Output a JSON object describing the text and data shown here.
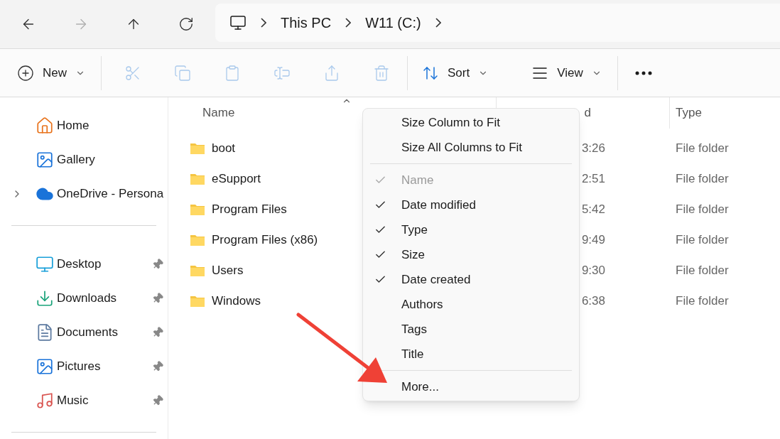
{
  "nav": [
    {
      "kind": "back",
      "disabled": false
    },
    {
      "kind": "forward",
      "disabled": true
    },
    {
      "kind": "up",
      "disabled": false
    },
    {
      "kind": "refresh",
      "disabled": false
    }
  ],
  "breadcrumb": [
    "This PC",
    "W11 (C:)"
  ],
  "toolbar": {
    "new": "New",
    "actions": [
      {
        "kind": "cut",
        "disabled": true
      },
      {
        "kind": "copy",
        "disabled": true
      },
      {
        "kind": "paste",
        "disabled": true
      },
      {
        "kind": "rename",
        "disabled": true
      },
      {
        "kind": "share",
        "disabled": true
      },
      {
        "kind": "delete",
        "disabled": true
      }
    ],
    "sort": "Sort",
    "view": "View"
  },
  "sidebar": {
    "groups": [
      [
        {
          "kind": "home",
          "label": "Home",
          "pinned": false,
          "expandable": false
        },
        {
          "kind": "gallery",
          "label": "Gallery",
          "pinned": false,
          "expandable": false
        },
        {
          "kind": "cloud",
          "label": "OneDrive - Persona",
          "pinned": false,
          "expandable": true
        }
      ],
      [
        {
          "kind": "desktop",
          "label": "Desktop",
          "pinned": true,
          "expandable": false
        },
        {
          "kind": "downloads",
          "label": "Downloads",
          "pinned": true,
          "expandable": false
        },
        {
          "kind": "documents",
          "label": "Documents",
          "pinned": true,
          "expandable": false
        },
        {
          "kind": "pictures",
          "label": "Pictures",
          "pinned": true,
          "expandable": false
        },
        {
          "kind": "music",
          "label": "Music",
          "pinned": true,
          "expandable": false
        }
      ]
    ]
  },
  "table": {
    "columns": [
      "Name",
      "d",
      "Type"
    ],
    "rows": [
      {
        "name": "boot",
        "column_2": "3:26",
        "type": "File folder"
      },
      {
        "name": "eSupport",
        "column_2": "2:51",
        "type": "File folder"
      },
      {
        "name": "Program Files",
        "column_2": "5:42",
        "type": "File folder"
      },
      {
        "name": "Program Files (x86)",
        "column_2": "9:49",
        "type": "File folder"
      },
      {
        "name": "Users",
        "column_2": "9:30",
        "type": "File folder"
      },
      {
        "name": "Windows",
        "column_2": "6:38",
        "type": "File folder"
      }
    ]
  },
  "context_menu": {
    "items": [
      {
        "kind": "action",
        "label": "Size Column to Fit"
      },
      {
        "kind": "action",
        "label": "Size All Columns to Fit"
      },
      {
        "kind": "separator"
      },
      {
        "kind": "check",
        "label": "Name",
        "checked": true,
        "disabled": true
      },
      {
        "kind": "check",
        "label": "Date modified",
        "checked": true,
        "disabled": false
      },
      {
        "kind": "check",
        "label": "Type",
        "checked": true,
        "disabled": false
      },
      {
        "kind": "check",
        "label": "Size",
        "checked": true,
        "disabled": false
      },
      {
        "kind": "check",
        "label": "Date created",
        "checked": true,
        "disabled": false
      },
      {
        "kind": "check",
        "label": "Authors",
        "checked": false,
        "disabled": false
      },
      {
        "kind": "check",
        "label": "Tags",
        "checked": false,
        "disabled": false
      },
      {
        "kind": "check",
        "label": "Title",
        "checked": false,
        "disabled": false
      },
      {
        "kind": "separator"
      },
      {
        "kind": "action",
        "label": "More..."
      }
    ]
  }
}
